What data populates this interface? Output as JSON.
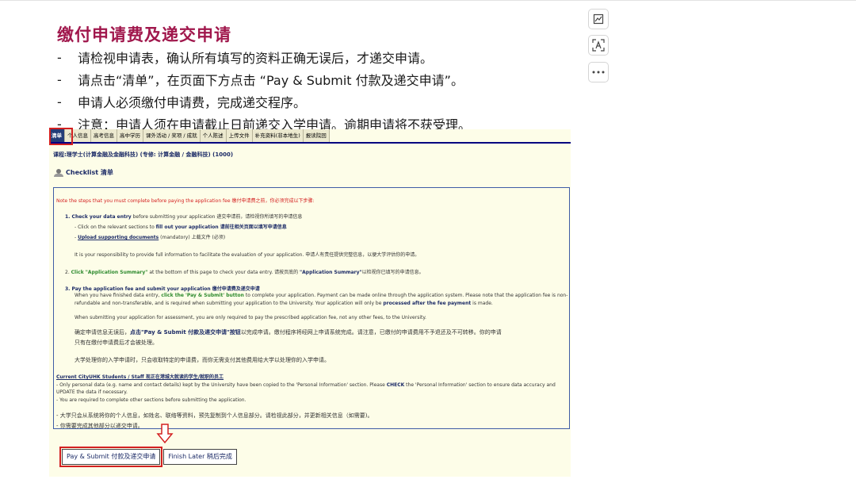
{
  "slide": {
    "title": "缴付申请费及递交申请",
    "bullets": [
      "请检视申请表，确认所有填写的资料正确无误后，才递交申请。",
      "请点击“清单”，在页面下方点击 “Pay & Submit 付款及递交申请”。",
      "申请人必须缴付申请费，完成递交程序。",
      "注意：申请人须在申请截止日前递交入学申请。逾期申请将不获受理。"
    ]
  },
  "tabs": [
    "清单",
    "个人信息",
    "高考信息",
    "高中学历",
    "课外活动 / 奖项 / 成就",
    "个人陈述",
    "上传文件",
    "补充资料(非本地生)",
    "报读院回"
  ],
  "course": "课程:理学士(计算金融及金融科技) (专修: 计算金融 / 金融科技) (1000)",
  "checklist_title": "Checklist 清单",
  "box": {
    "intro": "Note the steps that you must complete before paying the application fee 缴付申请费之前，你必须完成以下步骤:",
    "s1_title_en": "1. Check your data entry",
    "s1_title_rest": " before submitting your application 递交申请前，请检视你所填写的申请信息",
    "s1_a": "- Click on the relevant sections to ",
    "s1_a_bold": "fill out your application 请前往相关页面以填写申请信息",
    "s1_b_link": "Upload supporting documents",
    "s1_b_rest": " (mandatory) 上载文件 (必须)",
    "s1_note": "It is your responsibility to provide full information to facilitate the evaluation of your application. 申请人有责任提供完整信息，以便大学评估你的申请。",
    "s2_num": "2. ",
    "s2_green": "Click \"Application Summary\"",
    "s2_rest": " at the bottom of this page to check your data entry. 请按页底的 ",
    "s2_bold": "\"Application Summary\"",
    "s2_end": "以检视你已填写的申请信息。",
    "s3_title": "3. Pay the application fee and submit your application 缴付申请费及递交申请",
    "s3_l1_a": "When you have finished data entry, ",
    "s3_l1_green": "click the 'Pay & Submit' button",
    "s3_l1_b": " to complete your application. Payment can be made online through the application system. Please note that the application fee is non-",
    "s3_l2_a": "refundable and non-transferable, and is required when submitting your application to the University. Your application will only be ",
    "s3_l2_bold": "processed after the fee payment",
    "s3_l2_b": " is made.",
    "s3_l3": "When submitting your application for assessment, you are only required to pay the prescribed application fee, not any other fees, to the University.",
    "s3_cn1_a": "确定申请信息无误后，",
    "s3_cn1_bold": "点击\"Pay & Submit 付款及递交申请\"按钮",
    "s3_cn1_b": "以完成申请。缴付程序将经网上申请系统完成。请注意，已缴付的申请费用不予退还及不可转移。你的申请",
    "s3_cn2": "只有在缴付申请费后才会被处理。",
    "s3_cn3": "大学处理你的入学申请时，只会收取特定的申请费，而你无需支付其他费用给大学以处理你的入学申请。",
    "current_title": "Current CityUHK Students / Staff 现正在港城大就读的学生/就职的员工",
    "cur1_a": "- Only personal data (e.g. name and contact details) kept by the University have been copied to the 'Personal Information' section. Please ",
    "cur1_bold": "CHECK",
    "cur1_b": " the 'Personal Information' section to ensure data accuracy and",
    "cur2": "UPDATE the data if necessary.",
    "cur3": "- You are required to complete other sections before submitting the application.",
    "cur_cn1": "- 大学只会从系统将你的个人信息，如姓名、联络等资料，预先复制到个人信息部分。请检视此部分，并更新相关信息（如需要)。",
    "cur_cn2": "- 你需要完成其他部分以递交申请。"
  },
  "buttons": {
    "pay_submit": "Pay & Submit 付款及递交申请",
    "finish_later": "Finish Later 稍后完成"
  },
  "side_tools": [
    "image-edit-icon",
    "text-recognition-icon",
    "more-icon"
  ],
  "colors": {
    "title": "#a0174c",
    "highlight": "#d32020",
    "nav": "#233c78",
    "panel_bg": "#fdfde8"
  }
}
